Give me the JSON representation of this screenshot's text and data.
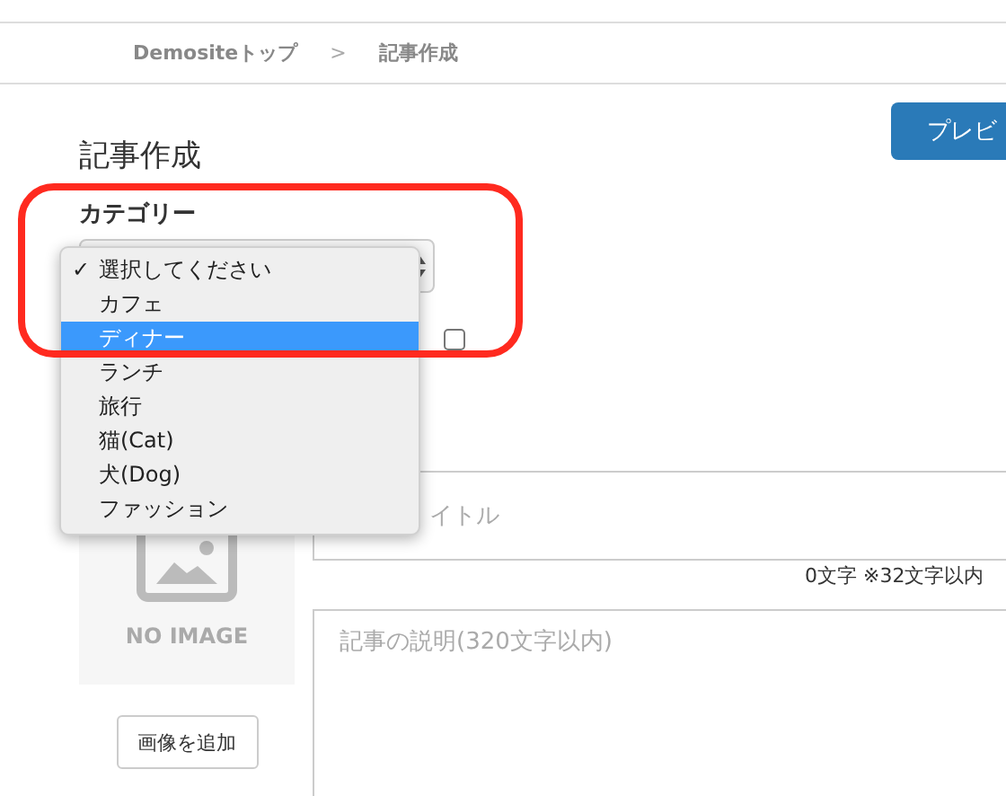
{
  "breadcrumb": {
    "items": [
      {
        "label": "Demositeトップ"
      },
      {
        "label": "記事作成"
      }
    ],
    "separator": ">"
  },
  "page_title": "記事作成",
  "category": {
    "label": "カテゴリー",
    "check_glyph": "✓",
    "options": [
      {
        "label": "選択してください",
        "checked": true,
        "selected": false
      },
      {
        "label": "カフェ",
        "checked": false,
        "selected": false
      },
      {
        "label": "ディナー",
        "checked": false,
        "selected": true
      },
      {
        "label": "ランチ",
        "checked": false,
        "selected": false
      },
      {
        "label": "旅行",
        "checked": false,
        "selected": false
      },
      {
        "label": "猫(Cat)",
        "checked": false,
        "selected": false
      },
      {
        "label": "犬(Dog)",
        "checked": false,
        "selected": false
      },
      {
        "label": "ファッション",
        "checked": false,
        "selected": false
      }
    ]
  },
  "checkbox": {
    "checked": false
  },
  "preview_button": "プレビ",
  "title_field": {
    "placeholder": "イトル"
  },
  "counter": "0文字 ※32文字以内",
  "image": {
    "label": "NO IMAGE"
  },
  "add_image_button": "画像を追加",
  "description_field": {
    "placeholder": "記事の説明(320文字以内)"
  }
}
